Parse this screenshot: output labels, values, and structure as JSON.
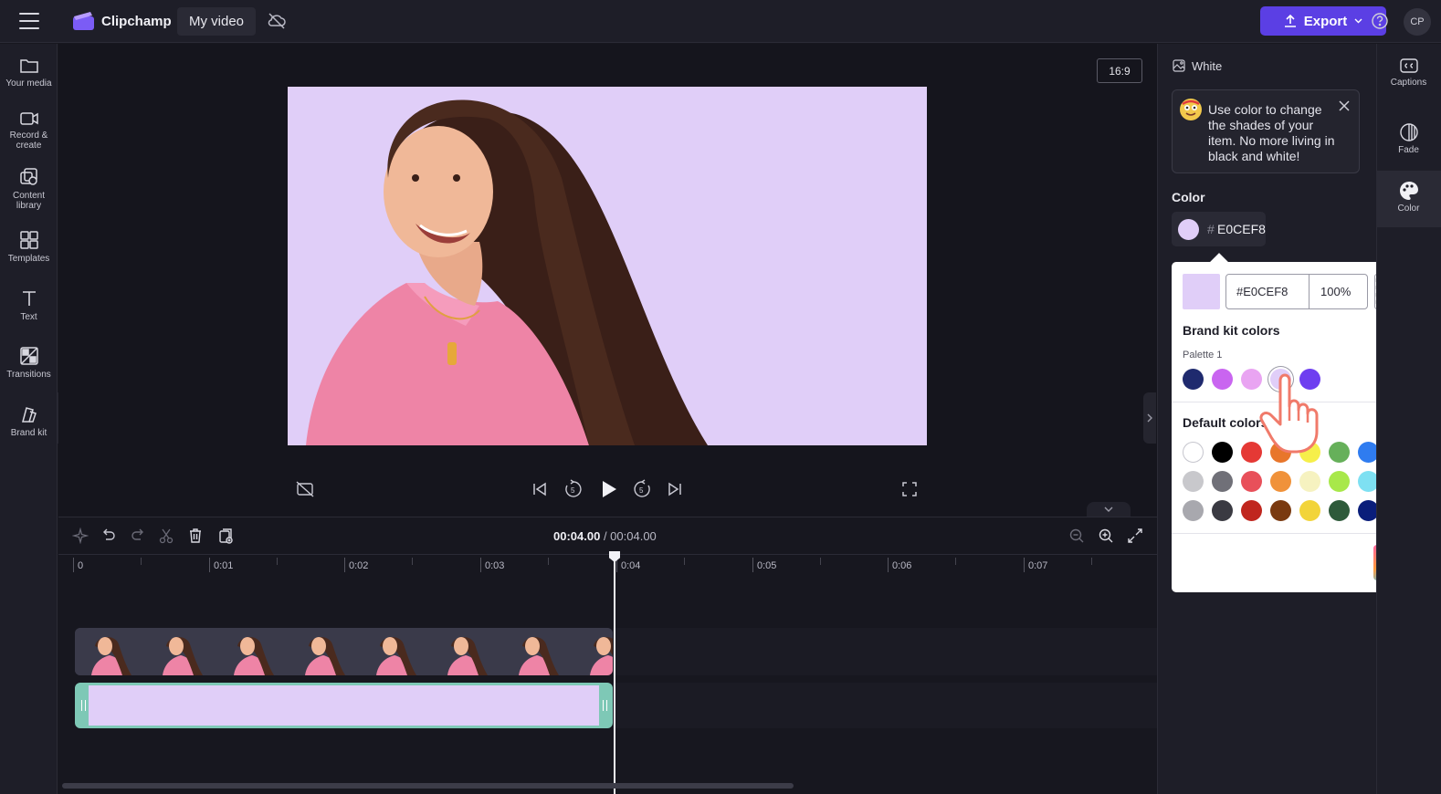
{
  "app": {
    "name": "Clipchamp",
    "project_name": "My video",
    "export_label": "Export",
    "avatar_initials": "CP"
  },
  "sidebar": {
    "items": [
      {
        "label": "Your media",
        "icon": "folder-icon"
      },
      {
        "label": "Record &\ncreate",
        "icon": "camera-icon"
      },
      {
        "label": "Content\nlibrary",
        "icon": "library-icon"
      },
      {
        "label": "Templates",
        "icon": "templates-icon"
      },
      {
        "label": "Text",
        "icon": "text-icon"
      },
      {
        "label": "Transitions",
        "icon": "transitions-icon"
      },
      {
        "label": "Brand kit",
        "icon": "brand-kit-icon"
      }
    ]
  },
  "preview": {
    "aspect_ratio": "16:9",
    "background_color": "#E0CEF8"
  },
  "timeline": {
    "current_time": "00:04.00",
    "separator": " / ",
    "total_time": "00:04.00",
    "ruler_labels": [
      "0",
      "0:01",
      "0:02",
      "0:03",
      "0:04",
      "0:05",
      "0:06",
      "0:07"
    ]
  },
  "properties": {
    "item_title": "White",
    "tip_text": "Use color to change the shades of your item. No more living in black and white!",
    "color_heading": "Color",
    "color_hash": "#",
    "color_hex": "E0CEF8",
    "picker": {
      "hex_value": "#E0CEF8",
      "opacity": "100%",
      "brand_kit_heading": "Brand kit colors",
      "palette_label": "Palette 1",
      "brand_colors": [
        "#1f2a6e",
        "#c965f0",
        "#e9a4f2",
        "#e0cef8",
        "#6e3ef0"
      ],
      "selected_brand_color": "#e0cef8",
      "default_heading": "Default colors",
      "default_colors": [
        [
          "#ffffff",
          "#000000",
          "#e53935",
          "#e8762b",
          "#f6ef4a",
          "#66b05a",
          "#2f7cf0",
          "#e36cf0"
        ],
        [
          "#c8c8cc",
          "#707078",
          "#e8505a",
          "#f0923a",
          "#f6f2c0",
          "#a8e84a",
          "#7ee0f2",
          "#a13cf0"
        ],
        [
          "#a8a8ae",
          "#3a3a42",
          "#c0261e",
          "#7a3a10",
          "#f2d43a",
          "#2e5a3a",
          "#0a1e7a",
          "#7a20f0"
        ]
      ]
    }
  },
  "right_tabs": [
    {
      "label": "Captions",
      "icon": "captions-icon"
    },
    {
      "label": "Fade",
      "icon": "fade-icon"
    },
    {
      "label": "Color",
      "icon": "color-palette-icon",
      "active": true
    }
  ]
}
